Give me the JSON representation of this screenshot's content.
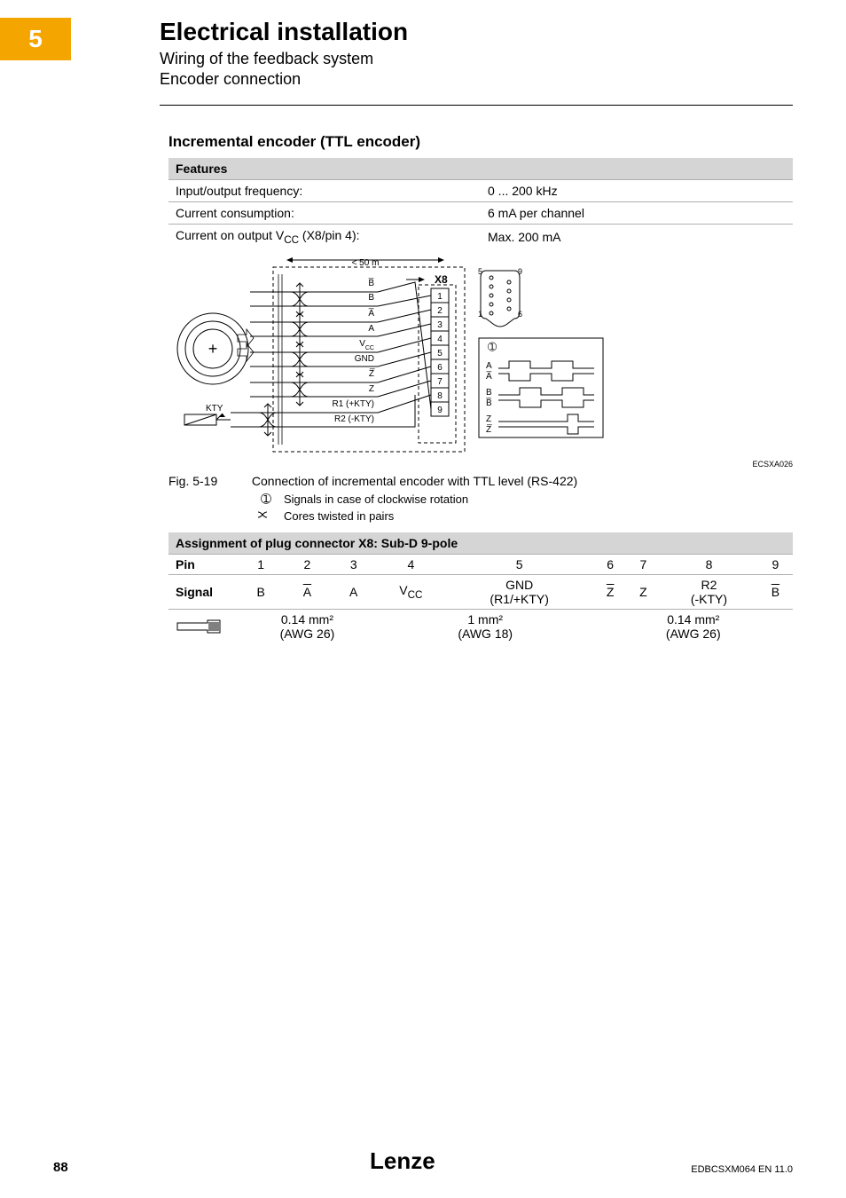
{
  "chapter_number": "5",
  "chapter_title": "Electrical installation",
  "subheading1": "Wiring of the feedback system",
  "subheading2": "Encoder connection",
  "section_title": "Incremental encoder (TTL encoder)",
  "features": {
    "header": "Features",
    "rows": [
      {
        "label": "Input/output frequency:",
        "value": "0 ... 200 kHz"
      },
      {
        "label": "Current consumption:",
        "value": "6 mA per channel"
      },
      {
        "label": "Current on output Vᴄᴄ (X8/pin 4):",
        "value": "Max. 200 mA"
      }
    ]
  },
  "figure": {
    "code": "ECSXA026",
    "number": "Fig. 5-19",
    "caption": "Connection of incremental encoder with TTL level (RS-422)",
    "legend": [
      {
        "sym": "➀",
        "text": "Signals in case of clockwise rotation"
      },
      {
        "sym": "twist",
        "text": "Cores twisted in pairs"
      }
    ],
    "diagram": {
      "length_label": "< 50 m",
      "connector_label": "X8",
      "encoder_label": "+",
      "sensor_label": "KTY",
      "conn_top_left": "5",
      "conn_top_right": "9",
      "conn_bot_left": "1",
      "conn_bot_right": "6",
      "signal_labels": [
        "B̅",
        "B",
        "A̅",
        "A",
        "Vᴄᴄ",
        "GND",
        "Z̅",
        "Z",
        "R1 (+KTY)",
        "R2 (-KTY)"
      ],
      "pin_labels": [
        "1",
        "2",
        "3",
        "4",
        "5",
        "6",
        "7",
        "8",
        "9"
      ],
      "wave_labels": [
        "A",
        "A̅",
        "B",
        "B̅",
        "Z",
        "Z̅"
      ],
      "wave_marker": "➀"
    }
  },
  "assignment": {
    "header": "Assignment of plug connector X8: Sub-D 9-pole",
    "pin_label": "Pin",
    "signal_label": "Signal",
    "pins": [
      "1",
      "2",
      "3",
      "4",
      "5",
      "6",
      "7",
      "8",
      "9"
    ],
    "signals": [
      "B",
      "A̅",
      "A",
      "Vᴄᴄ",
      "GND\n(R1/+KTY)",
      "Z̅",
      "Z",
      "R2\n(-KTY)",
      "B̅"
    ],
    "cable_groups": [
      {
        "span": 3,
        "text_top": "0.14 mm²",
        "text_bot": "(AWG 26)"
      },
      {
        "span": 2,
        "text_top": "1 mm²",
        "text_bot": "(AWG 18)"
      },
      {
        "span": 4,
        "text_top": "0.14 mm²",
        "text_bot": "(AWG 26)"
      }
    ]
  },
  "footer": {
    "page": "88",
    "docid": "EDBCSXM064 EN 11.0",
    "brand": "Lenze"
  }
}
